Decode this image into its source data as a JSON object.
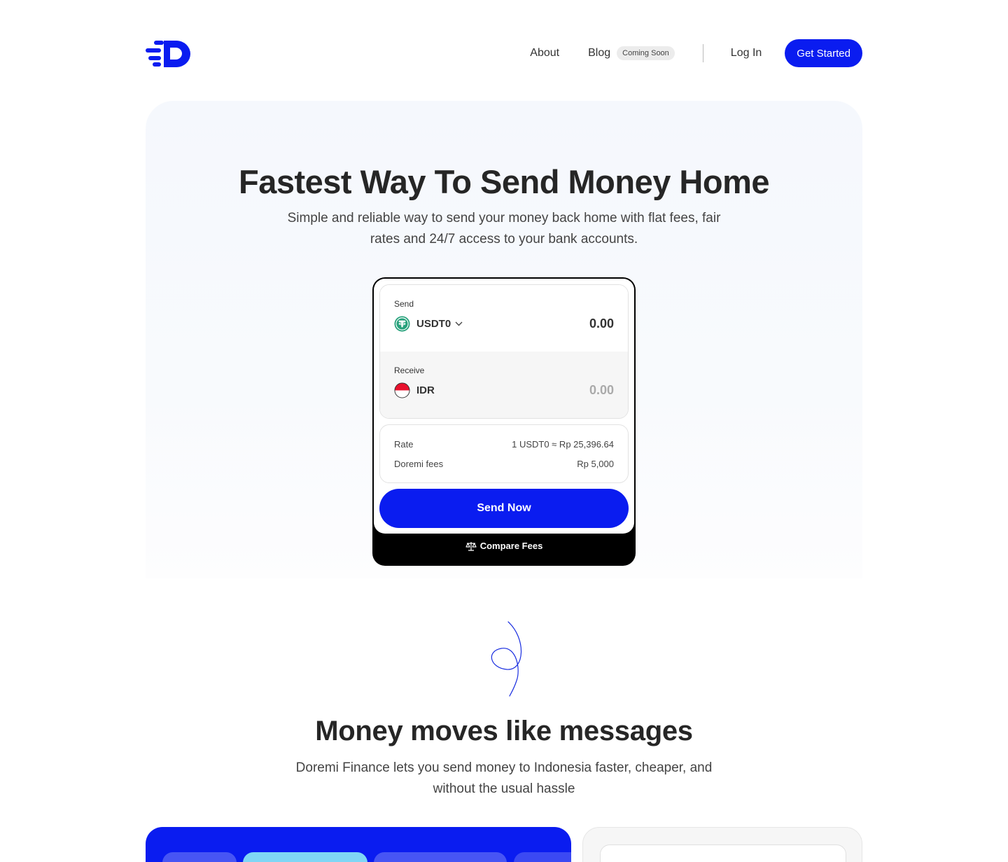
{
  "nav": {
    "about": "About",
    "blog": "Blog",
    "blog_badge": "Coming Soon",
    "login": "Log In",
    "get_started": "Get Started"
  },
  "hero": {
    "title": "Fastest Way To Send Money Home",
    "subtitle": "Simple and reliable way to send your money back home with flat fees, fair rates and 24/7 access to your bank accounts."
  },
  "widget": {
    "send_label": "Send",
    "send_currency": "USDT0",
    "send_amount": "0.00",
    "receive_label": "Receive",
    "receive_currency": "IDR",
    "receive_amount": "0.00",
    "rate_label": "Rate",
    "rate_value": "1 USDT0 ≈ Rp 25,396.64",
    "fees_label": "Doremi fees",
    "fees_value": "Rp 5,000",
    "send_button": "Send Now",
    "compare_fees": "Compare Fees"
  },
  "section": {
    "title": "Money moves like messages",
    "subtitle": "Doremi Finance lets you send money to Indonesia faster, cheaper, and without the usual hassle"
  },
  "colors": {
    "brand": "#0a1cf0",
    "tether": "#26a17b",
    "idr_red": "#e8112d"
  },
  "icons": {
    "logo": "doremi-logo",
    "usdt": "tether-icon",
    "idr": "indonesia-flag-icon",
    "chevron": "chevron-down-icon",
    "scale": "scale-icon"
  }
}
